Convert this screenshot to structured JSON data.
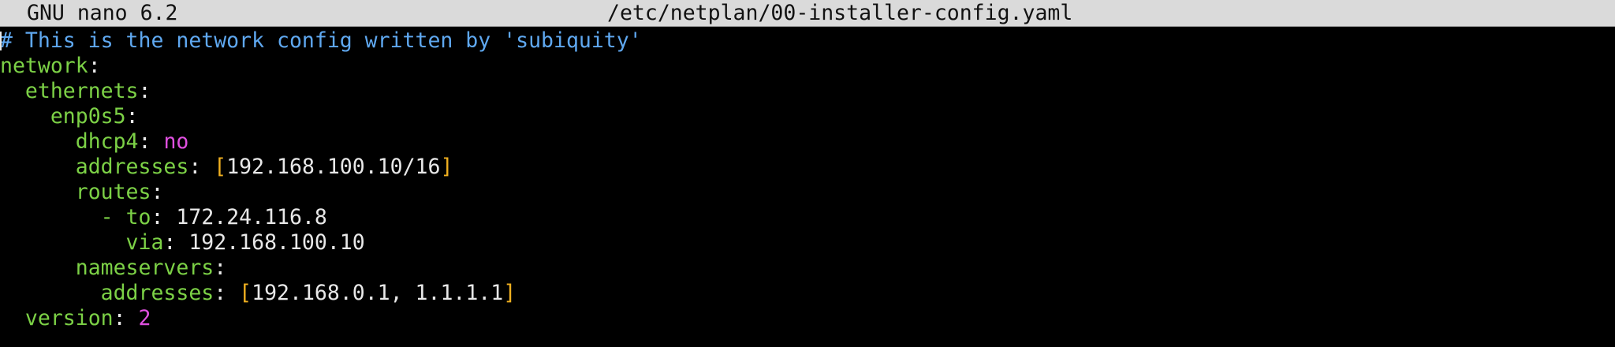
{
  "titlebar": {
    "app": "GNU nano 6.2",
    "file": "/etc/netplan/00-installer-config.yaml"
  },
  "lines": {
    "l1_comment": "# This is the network config written by 'subiquity'",
    "l2_key": "network",
    "l3_key": "ethernets",
    "l4_key": "enp0s5",
    "l5_key": "dhcp4",
    "l5_val": "no",
    "l6_key": "addresses",
    "l6_val": "192.168.100.10/16",
    "l7_key": "routes",
    "l8_key": "to",
    "l8_val": "172.24.116.8",
    "l9_key": "via",
    "l9_val": "192.168.100.10",
    "l10_key": "nameservers",
    "l11_key": "addresses",
    "l11_val": "192.168.0.1, 1.1.1.1",
    "l12_key": "version",
    "l12_val": "2"
  },
  "colors": {
    "comment": "#5fa8f0",
    "key": "#7cd146",
    "bool": "#e050e0",
    "bracket": "#f0b020",
    "titlebar_bg": "#dadada",
    "background": "#000000"
  }
}
